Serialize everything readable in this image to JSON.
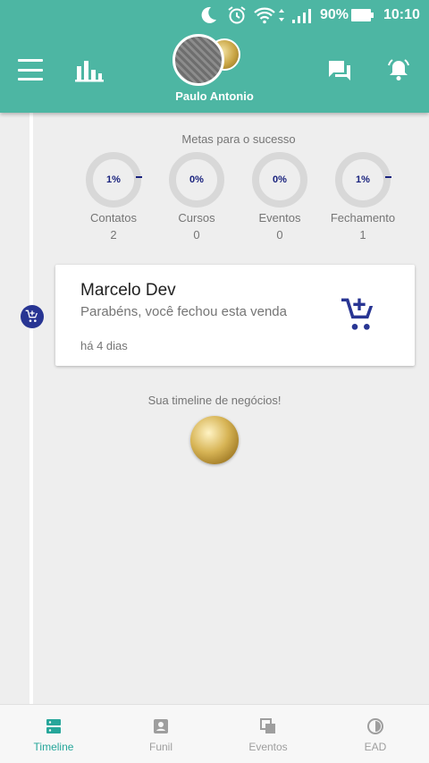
{
  "status_bar": {
    "battery": "90%",
    "time": "10:10"
  },
  "header": {
    "user_name": "Paulo Antonio"
  },
  "goals": {
    "title": "Metas para o sucesso",
    "items": [
      {
        "pct": "1%",
        "label": "Contatos",
        "count": "2"
      },
      {
        "pct": "0%",
        "label": "Cursos",
        "count": "0"
      },
      {
        "pct": "0%",
        "label": "Eventos",
        "count": "0"
      },
      {
        "pct": "1%",
        "label": "Fechamento",
        "count": "1"
      }
    ]
  },
  "timeline": {
    "card": {
      "name": "Marcelo Dev",
      "message": "Parabéns, você fechou esta venda",
      "time": "há 4 dias"
    },
    "footer_text": "Sua timeline de negócios!"
  },
  "bottom_nav": [
    {
      "label": "Timeline",
      "icon": "timeline-icon",
      "active": true
    },
    {
      "label": "Funil",
      "icon": "contact-card-icon",
      "active": false
    },
    {
      "label": "Eventos",
      "icon": "copy-icon",
      "active": false
    },
    {
      "label": "EAD",
      "icon": "pie-icon",
      "active": false
    }
  ],
  "colors": {
    "primary": "#4db6a3",
    "accent_dark": "#283593",
    "active_tab": "#26a69a"
  }
}
